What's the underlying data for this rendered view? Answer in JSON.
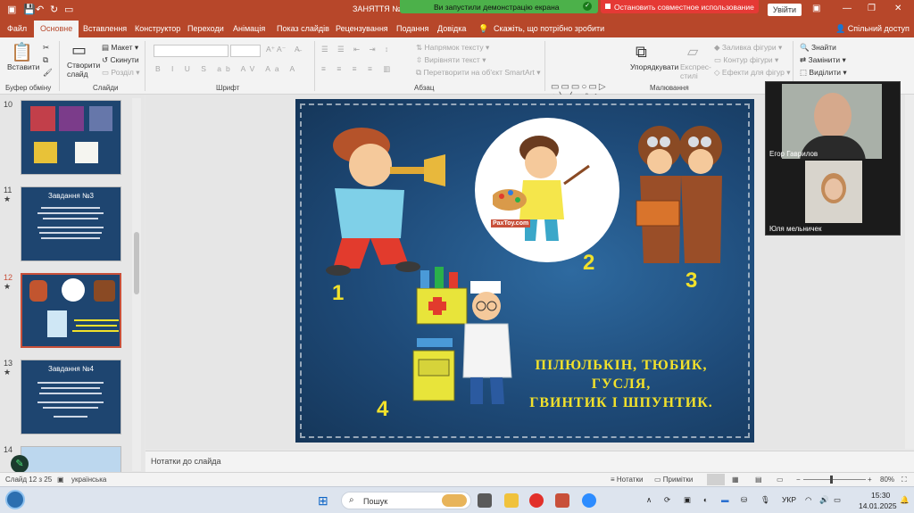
{
  "titlebar": {
    "doc_title": "ЗАНЯТТЯ №12",
    "share_notice": "Ви запустили демонстрацію екрана",
    "stop_share": "Остановить совместное использование",
    "login": "Увійти"
  },
  "tabs": [
    "Файл",
    "Основне",
    "Вставлення",
    "Конструктор",
    "Переходи",
    "Анімація",
    "Показ слайдів",
    "Рецензування",
    "Подання",
    "Довідка"
  ],
  "tell_me": "Скажіть, що потрібно зробити",
  "share_button": "Спільний доступ",
  "ribbon": {
    "paste": "Вставити",
    "new_slide": "Створити слайд",
    "layout": "Макет",
    "reset": "Скинути",
    "section": "Розділ",
    "text_direction": "Напрямок тексту",
    "align_text": "Вирівняти текст",
    "smartart": "Перетворити на об'єкт SmartArt",
    "arrange": "Упорядкувати",
    "quick_styles": "Експрес-стилі",
    "shape_fill": "Заливка фігури",
    "shape_outline": "Контур фігури",
    "shape_effects": "Ефекти для фігур",
    "find": "Знайти",
    "replace": "Замінити",
    "select": "Виділити",
    "groups": {
      "clipboard": "Буфер обміну",
      "slides": "Слайди",
      "font": "Шрифт",
      "paragraph": "Абзац",
      "drawing": "Малювання",
      "editing": "Редагування"
    }
  },
  "thumbnails": [
    {
      "num": "10",
      "star": "★",
      "title": ""
    },
    {
      "num": "11",
      "star": "★",
      "title": "Завдання №3"
    },
    {
      "num": "12",
      "star": "★",
      "title": ""
    },
    {
      "num": "13",
      "star": "★",
      "title": "Завдання №4"
    },
    {
      "num": "14",
      "star": "★",
      "title": ""
    }
  ],
  "slide": {
    "numbers": [
      "1",
      "2",
      "3",
      "4"
    ],
    "caption_lines": [
      "ПІЛЮЛЬКІН, ТЮБИК,",
      "ГУСЛЯ,",
      "ГВИНТИК І ШПУНТИК."
    ],
    "watermark": "PaxToy.com"
  },
  "notes_placeholder": "Нотатки до слайда",
  "statusbar": {
    "slide_pos": "Слайд 12 з 25",
    "language": "українська",
    "notes": "Нотатки",
    "comments": "Примітки",
    "zoom": "80%"
  },
  "video": {
    "person1": "Егор Гаврилов",
    "person2": "Юля мельничек"
  },
  "taskbar": {
    "search": "Пошук",
    "lang": "УКР",
    "time": "15:30",
    "date": "14.01.2025"
  },
  "colors": {
    "accent": "#b7472a",
    "share_green": "#4cb14a",
    "stop_red": "#e53935",
    "caption_yellow": "#f2e12b"
  }
}
